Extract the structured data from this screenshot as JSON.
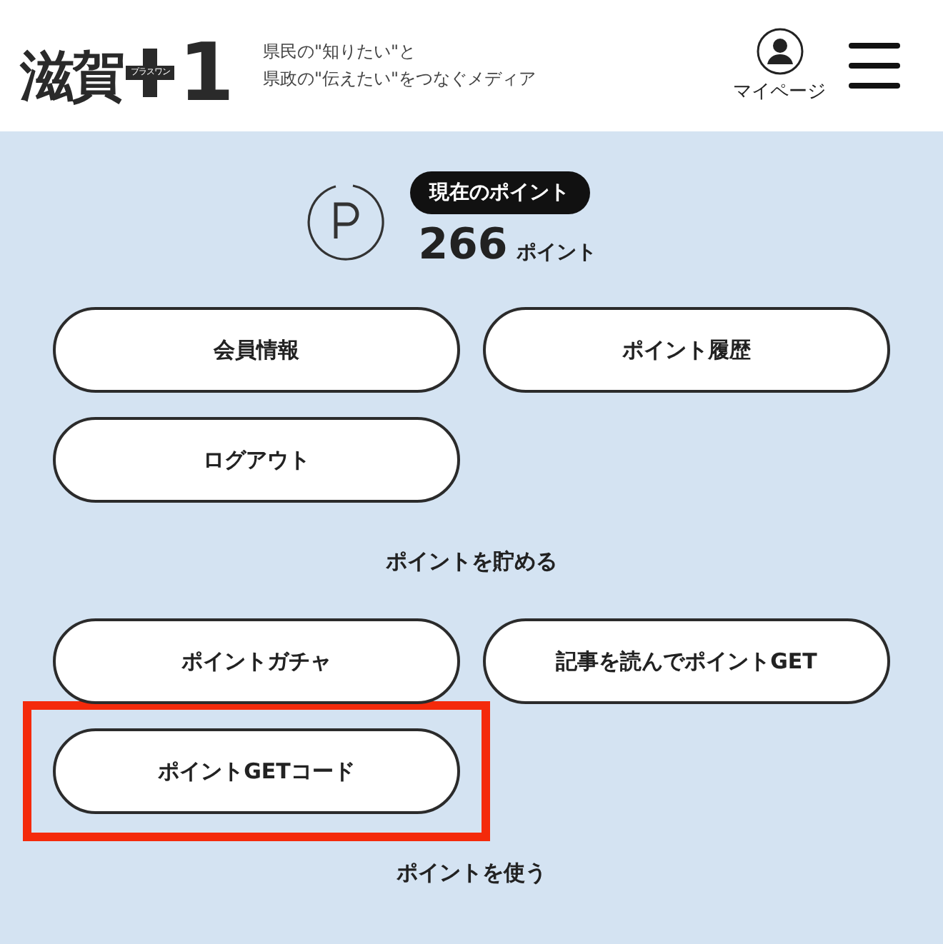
{
  "header": {
    "logo": {
      "name": "滋賀",
      "badge": "プラスワン",
      "digit": "1"
    },
    "tagline": [
      "県民の\"知りたい\"と",
      "県政の\"伝えたい\"をつなぐメディア"
    ],
    "mypage": "マイページ"
  },
  "points": {
    "label": "現在のポイント",
    "value": "266",
    "unit": "ポイント"
  },
  "account_buttons": [
    {
      "label": "会員情報",
      "highlighted": false
    },
    {
      "label": "ポイント履歴",
      "highlighted": false
    },
    {
      "label": "ログアウト",
      "highlighted": false
    }
  ],
  "sections": [
    {
      "title": "ポイントを貯める",
      "buttons": [
        {
          "label": "ポイントガチャ",
          "highlighted": false
        },
        {
          "label": "記事を読んでポイントGET",
          "highlighted": false
        },
        {
          "label": "ポイントGETコード",
          "highlighted": true
        }
      ]
    },
    {
      "title": "ポイントを使う"
    }
  ]
}
